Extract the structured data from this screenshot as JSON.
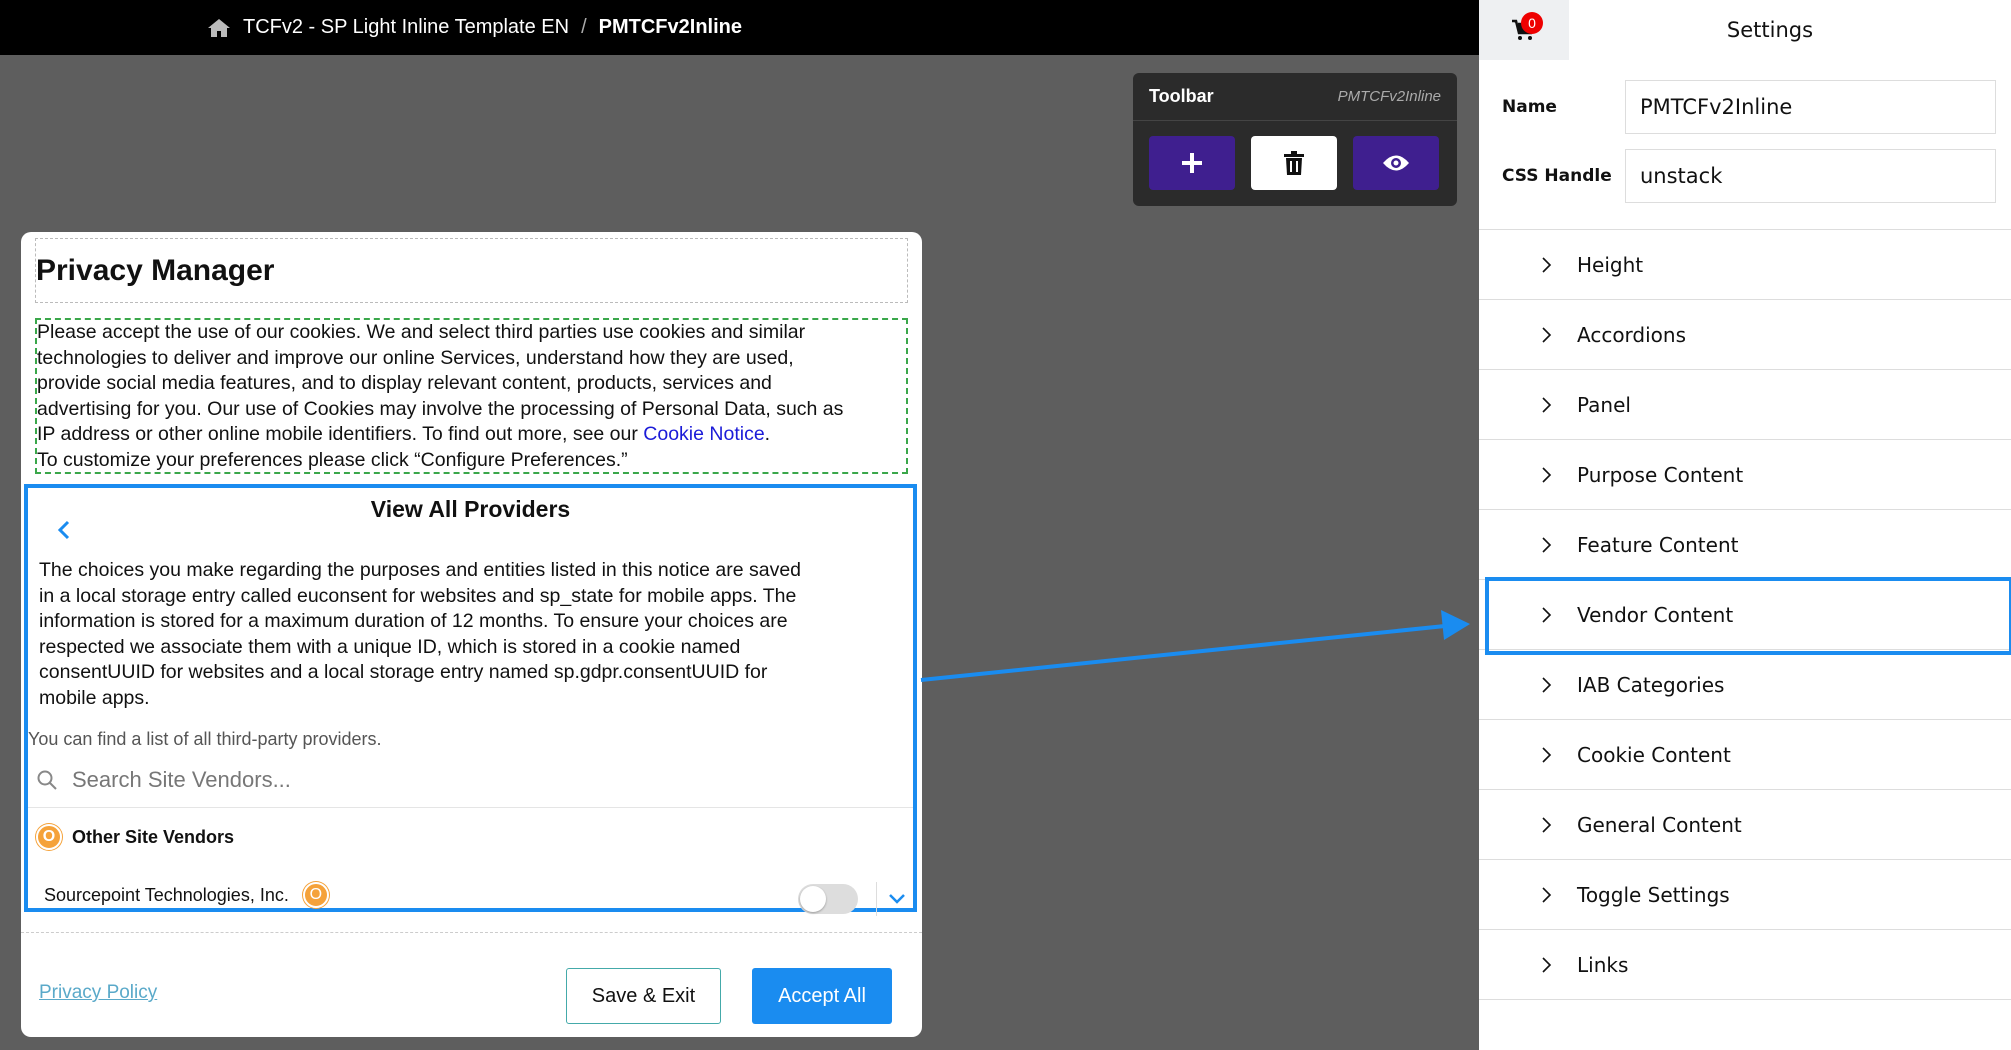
{
  "breadcrumb": {
    "parent": "TCFv2 - SP Light Inline Template EN",
    "separator": "/",
    "current": "PMTCFv2Inline"
  },
  "toolbar": {
    "title": "Toolbar",
    "subtitle": "PMTCFv2Inline"
  },
  "modal": {
    "title": "Privacy Manager",
    "desc_lines": [
      "Please accept the use of our cookies. We and select third parties use cookies and similar",
      "technologies to deliver and improve our online Services, understand how they are used,",
      "provide social media features, and to display relevant content, products, services and",
      "advertising for you. Our use of Cookies may involve the processing of Personal Data, such as",
      "IP address or other online mobile identifiers. To find out more, see our "
    ],
    "cookie_link": "Cookie Notice",
    "cookie_link_after": ".",
    "desc_last": "To customize your preferences please click “Configure Preferences.”",
    "providers": {
      "title": "View All Providers",
      "body_lines": [
        "The choices you make regarding the purposes and entities listed in this notice are saved",
        "in a local storage entry called euconsent for websites and sp_state for mobile apps. The",
        "information is stored for a maximum duration of 12 months. To ensure your choices are",
        "respected we associate them with a unique ID, which is stored in a cookie named",
        "consentUUID for websites and a local storage entry named sp.gdpr.consentUUID for",
        "mobile apps."
      ],
      "list_note": "You can find a list of all third-party providers.",
      "search_placeholder": "Search Site Vendors...",
      "group_badge": "O",
      "group_label": "Other Site Vendors",
      "vendor_name": "Sourcepoint Technologies, Inc.",
      "vendor_badge": "O"
    },
    "privacy_policy": "Privacy Policy",
    "save_exit": "Save & Exit",
    "accept_all": "Accept All"
  },
  "settings": {
    "cart_count": "0",
    "title": "Settings",
    "name_label": "Name",
    "name_value": "PMTCFv2Inline",
    "css_label": "CSS Handle",
    "css_value": "unstack",
    "accordions": [
      "Height",
      "Accordions",
      "Panel",
      "Purpose Content",
      "Feature Content",
      "Vendor Content",
      "IAB Categories",
      "Cookie Content",
      "General Content",
      "Toggle Settings",
      "Links"
    ],
    "highlighted": "Vendor Content"
  },
  "colors": {
    "highlight": "#1a8cf0",
    "toolbar_purple": "#3f1f8f",
    "badge_orange": "#f5a23a"
  }
}
